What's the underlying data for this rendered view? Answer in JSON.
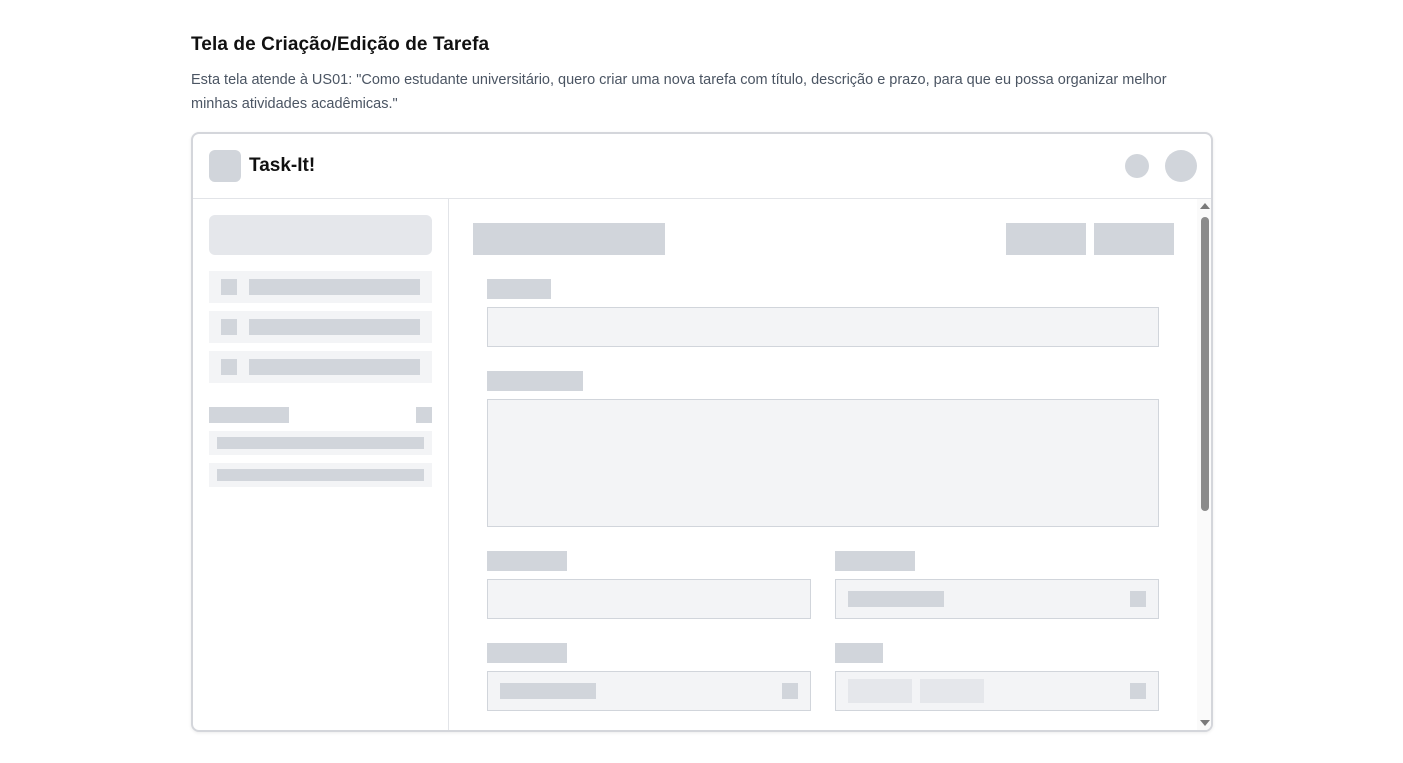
{
  "page": {
    "title": "Tela de Criação/Edição de Tarefa",
    "description": "Esta tela atende à US01: \"Como estudante universitário, quero criar uma nova tarefa com título, descrição e prazo, para que eu possa organizar melhor minhas atividades acadêmicas.\""
  },
  "app": {
    "name": "Task-It!",
    "header_icons": [
      "notification-icon",
      "avatar"
    ]
  },
  "sidebar": {
    "nav_items": 3,
    "section_items": 2
  },
  "form": {
    "fields": [
      "titulo",
      "descricao",
      "data",
      "prioridade",
      "categoria",
      "tags"
    ],
    "actions": [
      "cancel",
      "save"
    ]
  },
  "colors": {
    "skeleton": "#d1d5db",
    "field_bg": "#f3f4f6",
    "border": "#d4d6db"
  }
}
